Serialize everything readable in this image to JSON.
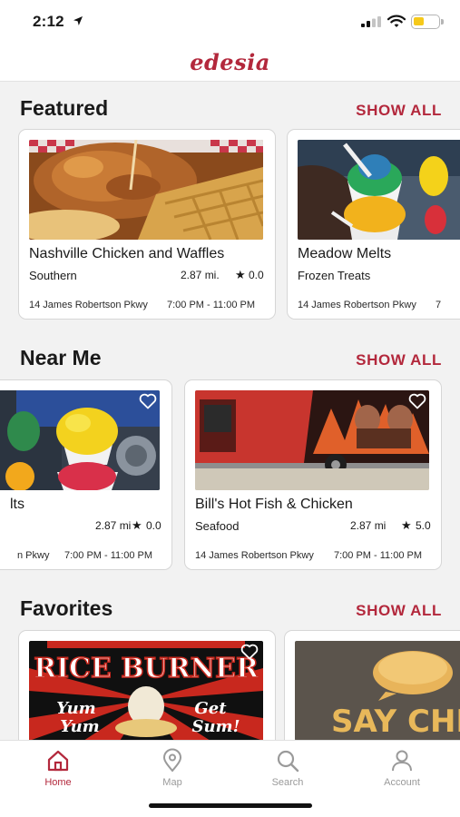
{
  "status_bar": {
    "time": "2:12"
  },
  "header": {
    "brand": "edesia"
  },
  "colors": {
    "accent": "#b3283c",
    "battery": "#f6c91a",
    "tab_inactive": "#9a9a9a"
  },
  "sections": {
    "featured": {
      "title": "Featured",
      "show_all": "SHOW ALL",
      "cards": [
        {
          "name": "Nashville Chicken and Waffles",
          "cuisine": "Southern",
          "distance": "2.87 mi.",
          "star": "★",
          "rating": "0.0",
          "address": "14 James Robertson Pkwy",
          "hours": "7:00 PM - 11:00 PM"
        },
        {
          "name": "Meadow Melts",
          "cuisine": "Frozen Treats",
          "address": "14 James Robertson Pkwy",
          "hours_partial": "7"
        }
      ]
    },
    "near_me": {
      "title": "Near Me",
      "show_all": "SHOW ALL",
      "cards": [
        {
          "name_partial": "lts",
          "distance": "2.87 mi",
          "star": "★",
          "rating": "0.0",
          "address_partial": "n Pkwy",
          "hours": "7:00 PM - 11:00 PM",
          "favorite_icon": "heart-outline-icon"
        },
        {
          "name": "Bill's Hot Fish & Chicken",
          "cuisine": "Seafood",
          "distance": "2.87 mi",
          "star": "★",
          "rating": "5.0",
          "address": "14 James Robertson Pkwy",
          "hours": "7:00 PM - 11:00 PM",
          "favorite_icon": "heart-outline-icon"
        }
      ]
    },
    "favorites": {
      "title": "Favorites",
      "show_all": "SHOW ALL",
      "cards": [
        {
          "image_text": {
            "line1": "RICE BURNER",
            "left1": "Yum",
            "left2": "Yum",
            "right1": "Get",
            "right2": "Sum!"
          },
          "favorite_icon": "heart-outline-icon"
        },
        {
          "image_text": {
            "line1": "SAY CHEE"
          }
        }
      ]
    }
  },
  "tab_bar": {
    "tabs": [
      {
        "label": "Home",
        "icon": "home-icon",
        "active": true
      },
      {
        "label": "Map",
        "icon": "map-pin-icon",
        "active": false
      },
      {
        "label": "Search",
        "icon": "search-icon",
        "active": false
      },
      {
        "label": "Account",
        "icon": "account-icon",
        "active": false
      }
    ]
  }
}
